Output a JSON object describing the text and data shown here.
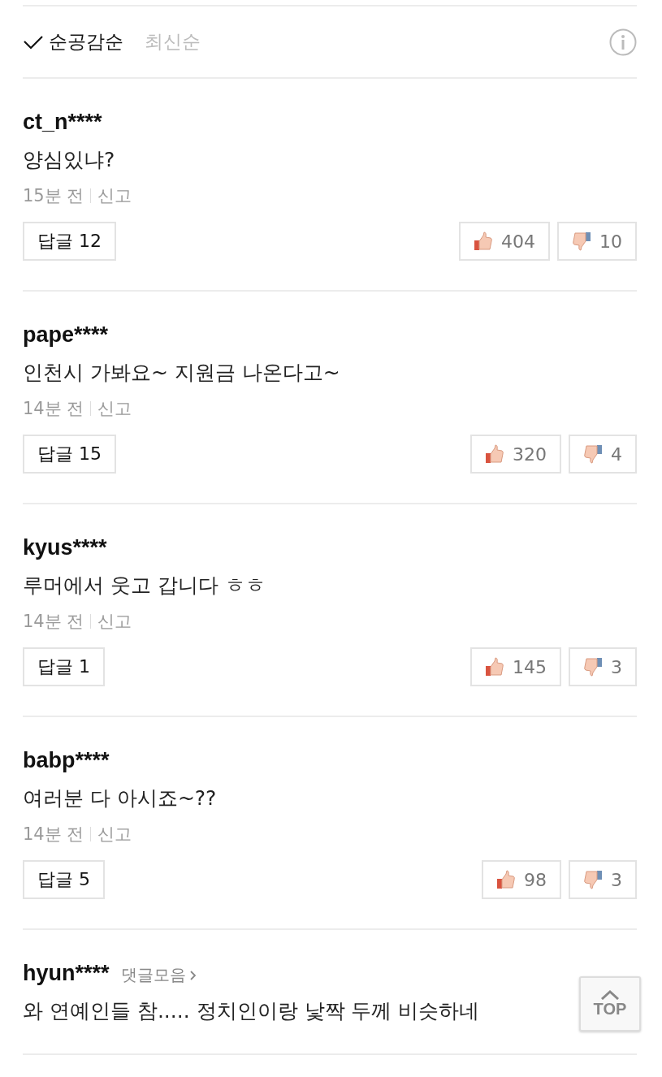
{
  "sort_options": [
    {
      "label": "순공감순",
      "selected": true
    },
    {
      "label": "최신순",
      "selected": false
    }
  ],
  "comments": [
    {
      "user": "ct_n****",
      "text": "양심있냐?",
      "time": "15분 전",
      "report": "신고",
      "reply_label": "답글",
      "reply_count": "12",
      "likes": "404",
      "dislikes": "10"
    },
    {
      "user": "pape****",
      "text": "인천시 가봐요~ 지원금 나온다고~",
      "time": "14분 전",
      "report": "신고",
      "reply_label": "답글",
      "reply_count": "15",
      "likes": "320",
      "dislikes": "4"
    },
    {
      "user": "kyus****",
      "text": "루머에서 웃고 갑니다 ㅎㅎ",
      "time": "14분 전",
      "report": "신고",
      "reply_label": "답글",
      "reply_count": "1",
      "likes": "145",
      "dislikes": "3"
    },
    {
      "user": "babp****",
      "text": "여러분 다 아시죠~??",
      "time": "14분 전",
      "report": "신고",
      "reply_label": "답글",
      "reply_count": "5",
      "likes": "98",
      "dislikes": "3"
    },
    {
      "user": "hyun****",
      "collection_link": "댓글모음",
      "text": "와 연예인들 참..... 정치인이랑 낯짝 두께 비슷하네"
    }
  ],
  "top_button": "TOP"
}
